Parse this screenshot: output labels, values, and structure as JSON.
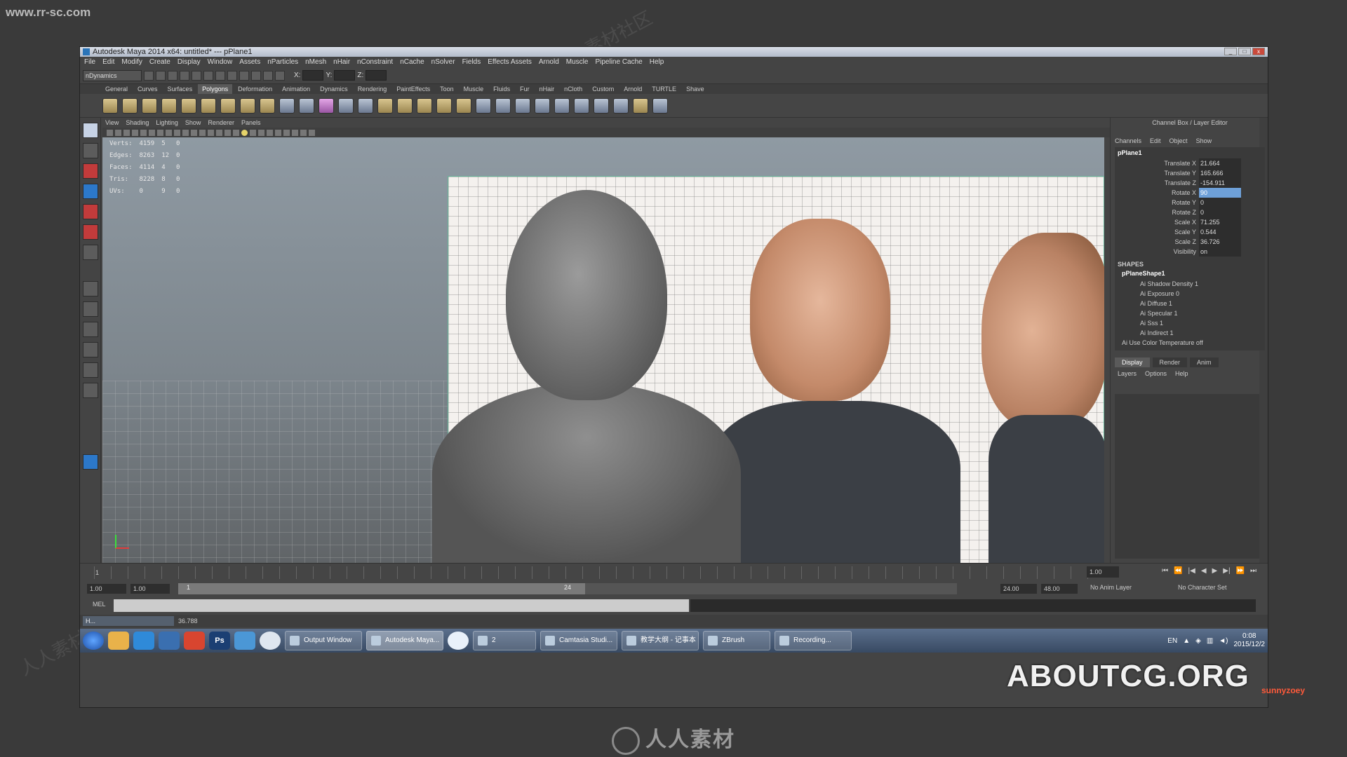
{
  "watermarks": {
    "site": "www.rr-sc.com",
    "bottom": "人人素材",
    "diag": "人人素材社区",
    "aboutcg": "ABOUTCG.ORG",
    "sunny": "sunnyzoey"
  },
  "window": {
    "title": "Autodesk Maya 2014 x64: untitled*   ---   pPlane1",
    "min": "_",
    "max": "□",
    "close": "x"
  },
  "menus": [
    "File",
    "Edit",
    "Modify",
    "Create",
    "Display",
    "Window",
    "Assets",
    "nParticles",
    "nMesh",
    "nHair",
    "nConstraint",
    "nCache",
    "nSolver",
    "Fields",
    "Effects Assets",
    "Arnold",
    "Muscle",
    "Pipeline Cache",
    "Help"
  ],
  "status": {
    "mode": "nDynamics",
    "x_label": "X:",
    "y_label": "Y:",
    "z_label": "Z:"
  },
  "shelf_tabs": [
    "General",
    "Curves",
    "Surfaces",
    "Polygons",
    "Deformation",
    "Animation",
    "Dynamics",
    "Rendering",
    "PaintEffects",
    "Toon",
    "Muscle",
    "Fluids",
    "Fur",
    "nHair",
    "nCloth",
    "Custom",
    "Arnold",
    "TURTLE",
    "Shave"
  ],
  "shelf_active": "Polygons",
  "panel_menu": [
    "View",
    "Shading",
    "Lighting",
    "Show",
    "Renderer",
    "Panels"
  ],
  "hud": [
    {
      "label": "Verts:",
      "a": "4159",
      "b": "5",
      "c": "0"
    },
    {
      "label": "Edges:",
      "a": "8263",
      "b": "12",
      "c": "0"
    },
    {
      "label": "Faces:",
      "a": "4114",
      "b": "4",
      "c": "0"
    },
    {
      "label": "Tris:",
      "a": "8228",
      "b": "8",
      "c": "0"
    },
    {
      "label": "UVs:",
      "a": "0",
      "b": "9",
      "c": "0"
    }
  ],
  "channel_box": {
    "title": "Channel Box / Layer Editor",
    "menu": [
      "Channels",
      "Edit",
      "Object",
      "Show"
    ],
    "object": "pPlane1",
    "attrs": [
      {
        "name": "Translate X",
        "value": "21.664"
      },
      {
        "name": "Translate Y",
        "value": "165.666"
      },
      {
        "name": "Translate Z",
        "value": "-154.911"
      },
      {
        "name": "Rotate X",
        "value": "90"
      },
      {
        "name": "Rotate Y",
        "value": "0"
      },
      {
        "name": "Rotate Z",
        "value": "0"
      },
      {
        "name": "Scale X",
        "value": "71.255"
      },
      {
        "name": "Scale Y",
        "value": "0.544"
      },
      {
        "name": "Scale Z",
        "value": "36.726"
      },
      {
        "name": "Visibility",
        "value": "on"
      }
    ],
    "shapes_header": "SHAPES",
    "shape_name": "pPlaneShape1",
    "shape_attrs": [
      "Ai Shadow Density 1",
      "Ai Exposure 0",
      "Ai Diffuse 1",
      "Ai Specular 1",
      "Ai Sss 1",
      "Ai Indirect 1",
      "Ai Use Color Temperature off"
    ],
    "layer_tabs": [
      "Display",
      "Render",
      "Anim"
    ],
    "layer_menu": [
      "Layers",
      "Options",
      "Help"
    ]
  },
  "timeline": {
    "start_tick": "1",
    "current_frame": "1.00",
    "range_start": "1.00",
    "range_inner_start": "1.00",
    "range_handle_start": "1",
    "range_handle_end": "24",
    "range_inner_end": "24.00",
    "range_end": "48.00",
    "anim_layer": "No Anim Layer",
    "char_set": "No Character Set"
  },
  "cmdline": {
    "label": "MEL"
  },
  "helpline": {
    "minimized": "H...",
    "coord": "36.788"
  },
  "taskbar": {
    "tasks": [
      "Output Window",
      "Autodesk Maya...",
      "2",
      "Camtasia Studi...",
      "教学大纲 - 记事本",
      "ZBrush",
      "Recording..."
    ],
    "active_task": "Autodesk Maya...",
    "lang": "EN",
    "time": "0:08",
    "date": "2015/12/2"
  }
}
